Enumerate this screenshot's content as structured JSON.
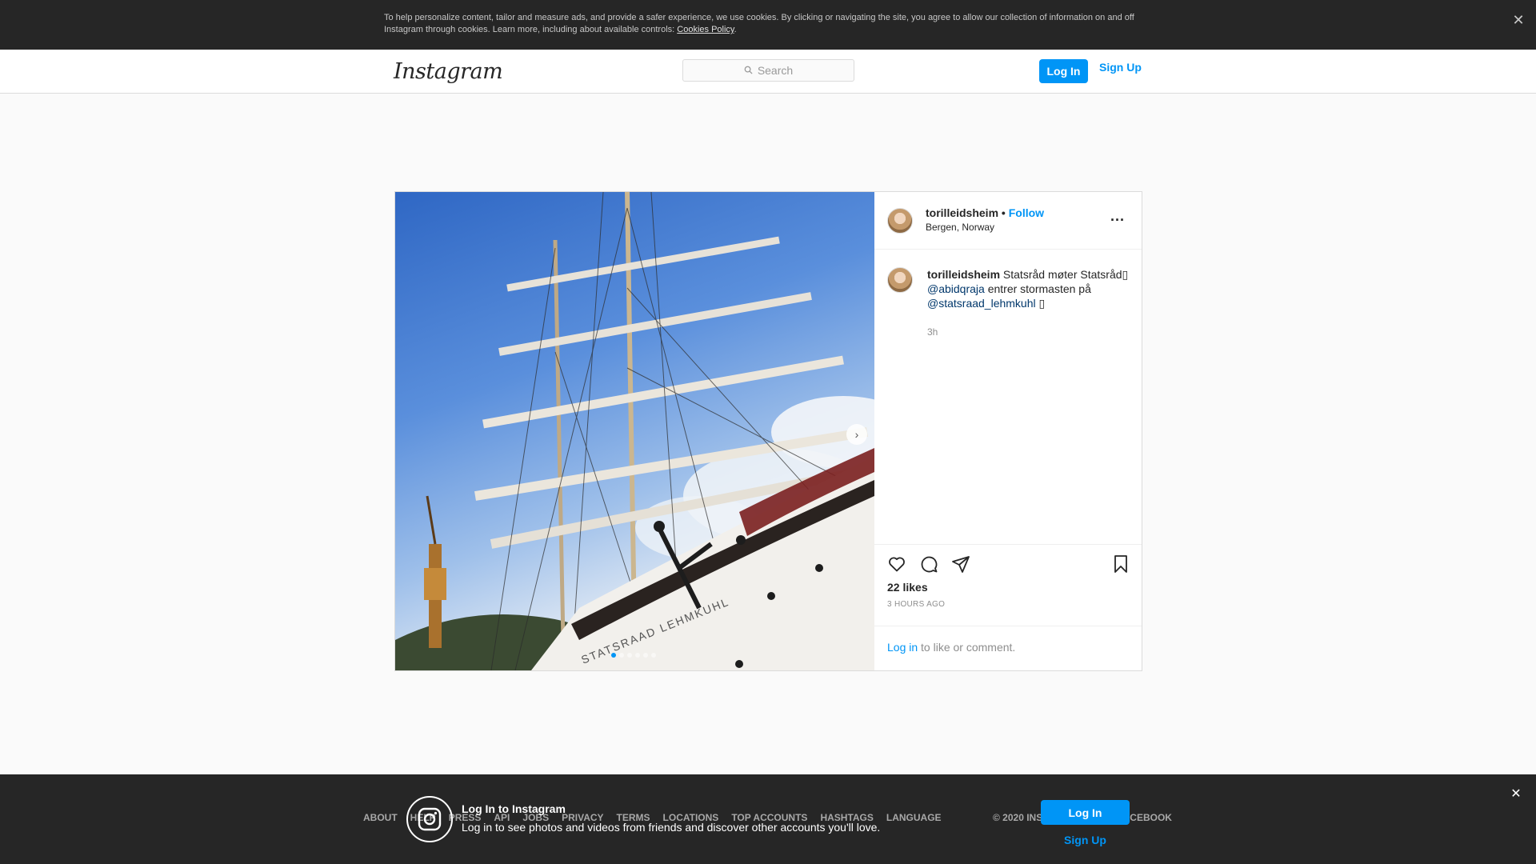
{
  "cookie_banner": {
    "text": "To help personalize content, tailor and measure ads, and provide a safer experience, we use cookies. By clicking or navigating the site, you agree to allow our collection of information on and off Instagram through cookies. Learn more, including about available controls: ",
    "link": "Cookies Policy",
    "close_icon": "close-icon"
  },
  "nav": {
    "logo": "Instagram",
    "search_placeholder": "Search",
    "login": "Log In",
    "signup": "Sign Up"
  },
  "post": {
    "username": "torilleidsheim",
    "separator": " • ",
    "follow": "Follow",
    "location": "Bergen, Norway",
    "more": "...",
    "caption": {
      "username": "torilleidsheim",
      "text1": " Statsråd møter Statsråd▯ ",
      "mention1": "@abidqraja",
      "text2": " entrer stormasten på ",
      "mention2": "@statsraad_lehmkuhl",
      "text3": " ▯",
      "time": "3h"
    },
    "likes": "22 likes",
    "ago": "3 HOURS AGO",
    "login_link": "Log in",
    "login_rest": " to like or comment.",
    "carousel_count": 6,
    "carousel_active": 0
  },
  "footer": {
    "links": [
      "ABOUT",
      "HELP",
      "PRESS",
      "API",
      "JOBS",
      "PRIVACY",
      "TERMS",
      "LOCATIONS",
      "TOP ACCOUNTS",
      "HASHTAGS",
      "LANGUAGE"
    ],
    "copyright": "© 2020 INSTAGRAM FROM FACEBOOK"
  },
  "login_banner": {
    "title": "Log In to Instagram",
    "subtitle": "Log in to see photos and videos from friends and discover other accounts you'll love.",
    "login": "Log In",
    "signup": "Sign Up"
  },
  "colors": {
    "accent": "#0095f6",
    "dark_banner": "#262626",
    "mention": "#00376b"
  }
}
